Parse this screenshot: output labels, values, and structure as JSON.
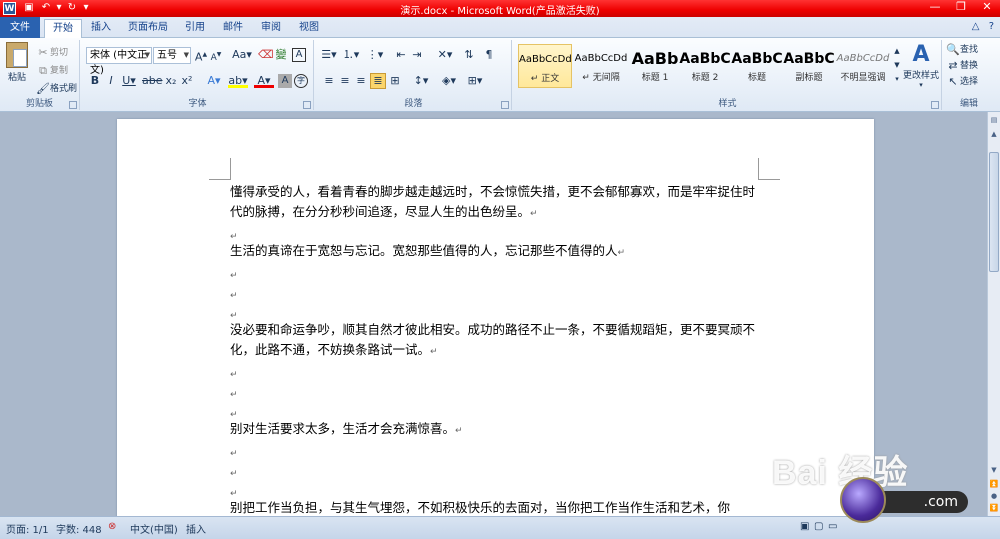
{
  "window": {
    "title": "演示.docx - Microsoft Word(产品激活失败)",
    "app_icon": "W"
  },
  "tabs": {
    "file": "文件",
    "items": [
      "开始",
      "插入",
      "页面布局",
      "引用",
      "邮件",
      "审阅",
      "视图"
    ]
  },
  "clipboard": {
    "paste": "粘贴",
    "cut": "剪切",
    "copy": "复制",
    "format_painter": "格式刷",
    "group": "剪贴板"
  },
  "font": {
    "name": "宋体 (中文正文)",
    "size": "五号",
    "group": "字体"
  },
  "paragraph": {
    "group": "段落"
  },
  "styles": {
    "group": "样式",
    "items": [
      {
        "sample": "AaBbCcDd",
        "name": "↵ 正文"
      },
      {
        "sample": "AaBbCcDd",
        "name": "↵ 无间隔"
      },
      {
        "sample": "AaBb",
        "name": "标题 1"
      },
      {
        "sample": "AaBbC",
        "name": "标题 2"
      },
      {
        "sample": "AaBbC",
        "name": "标题"
      },
      {
        "sample": "AaBbC",
        "name": "副标题"
      },
      {
        "sample": "AaBbCcDd",
        "name": "不明显强调"
      }
    ],
    "change": "更改样式"
  },
  "editing": {
    "find": "查找",
    "replace": "替换",
    "select": "选择",
    "group": "编辑"
  },
  "document": {
    "paragraphs": [
      {
        "text": "懂得承受的人，看着青春的脚步越走越远时，不会惊慌失措，更不会郁郁寡欢，而是牢牢捉住时代的脉搏，在分分秒秒间追逐，尽显人生的出色纷呈。"
      },
      {
        "text": ""
      },
      {
        "text": "生活的真谛在于宽恕与忘记。宽恕那些值得的人，忘记那些不值得的人"
      },
      {
        "text": ""
      },
      {
        "text": ""
      },
      {
        "text": ""
      },
      {
        "text": "没必要和命运争吵，顺其自然才彼此相安。成功的路径不止一条，不要循规蹈矩，更不要冥顽不化，此路不通，不妨换条路试一试。"
      },
      {
        "text": ""
      },
      {
        "text": ""
      },
      {
        "text": ""
      },
      {
        "text": "别对生活要求太多，生活才会充满惊喜。"
      },
      {
        "text": ""
      },
      {
        "text": ""
      },
      {
        "text": ""
      },
      {
        "text": "别把工作当负担，与其生气埋怨，不如积极快乐的去面对，当你把工作当作生活和艺术，你"
      }
    ],
    "para_mark": "↵"
  },
  "statusbar": {
    "page": "页面: 1/1",
    "words": "字数: 448",
    "language": "中文(中国)",
    "mode": "插入"
  },
  "watermark": {
    "brand": "Bai 经验",
    "url": "jingyan.baidu.com",
    "pill": ".com"
  },
  "colors": {
    "titlebar": "#e00000",
    "file_tab": "#2a62b0"
  }
}
